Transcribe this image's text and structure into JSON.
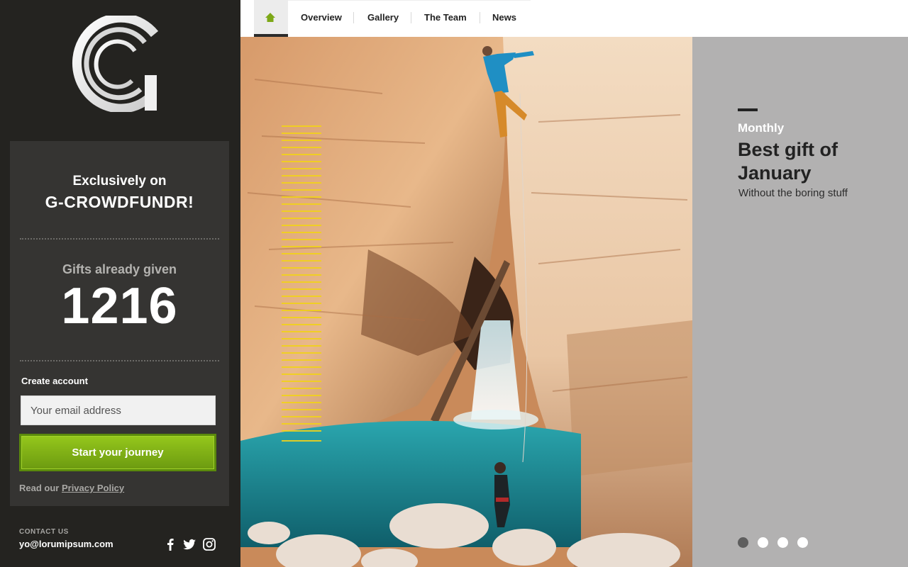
{
  "sidebar": {
    "logo_icon": "g-crowdfundr-logo",
    "exclusive_text": "Exclusively on",
    "brand_name": "G-CROWDFUNDR!",
    "gifts_label": "Gifts already given",
    "gifts_count": "1216",
    "create_account_label": "Create account",
    "email_placeholder": "Your email address",
    "cta_label": "Start your journey",
    "privacy_prefix": "Read our ",
    "privacy_link": "Privacy Policy",
    "contact_label": "CONTACT US",
    "contact_email": "yo@lorumipsum.com",
    "social_icons": [
      "facebook-icon",
      "twitter-icon",
      "instagram-icon"
    ]
  },
  "nav": {
    "home_icon": "home-icon",
    "items": [
      "Overview",
      "Gallery",
      "The Team",
      "News"
    ]
  },
  "hero": {
    "image": "rock-climber-canyon-waterfall-photo"
  },
  "panel": {
    "kicker": "Monthly",
    "title": "Best gift of January",
    "subtitle": "Without the boring stuff",
    "pager_count": 4,
    "pager_active": 1
  },
  "colors": {
    "sidebar_bg": "#242320",
    "card_bg": "#353432",
    "accent_green": "#8bbd18",
    "panel_bg": "#b2b1b1",
    "highlight_yellow": "#f2d21a"
  }
}
